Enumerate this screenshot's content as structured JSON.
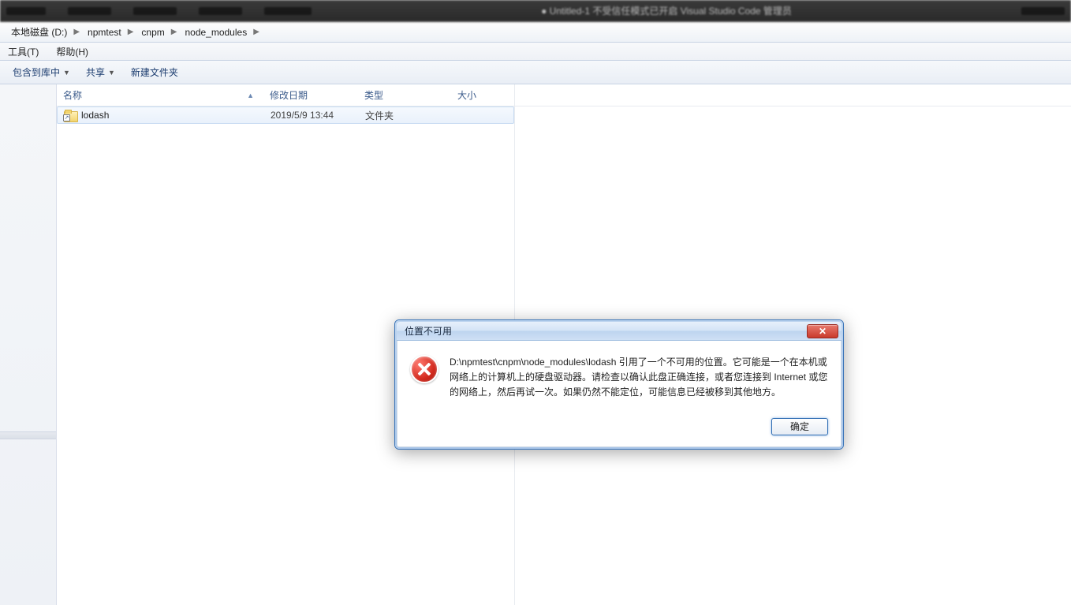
{
  "titlebar": {
    "center_text": "● Untitled-1    不受信任模式已开启    Visual Studio Code 管理员"
  },
  "breadcrumb": {
    "items": [
      "本地磁盘 (D:)",
      "npmtest",
      "cnpm",
      "node_modules"
    ]
  },
  "menu": {
    "tools": "工具(T)",
    "help": "帮助(H)"
  },
  "toolbar": {
    "include": "包含到库中",
    "share": "共享",
    "new_folder": "新建文件夹"
  },
  "columns": {
    "name": "名称",
    "date": "修改日期",
    "type": "类型",
    "size": "大小"
  },
  "rows": [
    {
      "name": "lodash",
      "date": "2019/5/9 13:44",
      "type": "文件夹",
      "size": ""
    }
  ],
  "dialog": {
    "title": "位置不可用",
    "message": "D:\\npmtest\\cnpm\\node_modules\\lodash 引用了一个不可用的位置。它可能是一个在本机或网络上的计算机上的硬盘驱动器。请检查以确认此盘正确连接，或者您连接到 Internet 或您的网络上，然后再试一次。如果仍然不能定位，可能信息已经被移到其他地方。",
    "ok": "确定",
    "close_glyph": "✕"
  }
}
